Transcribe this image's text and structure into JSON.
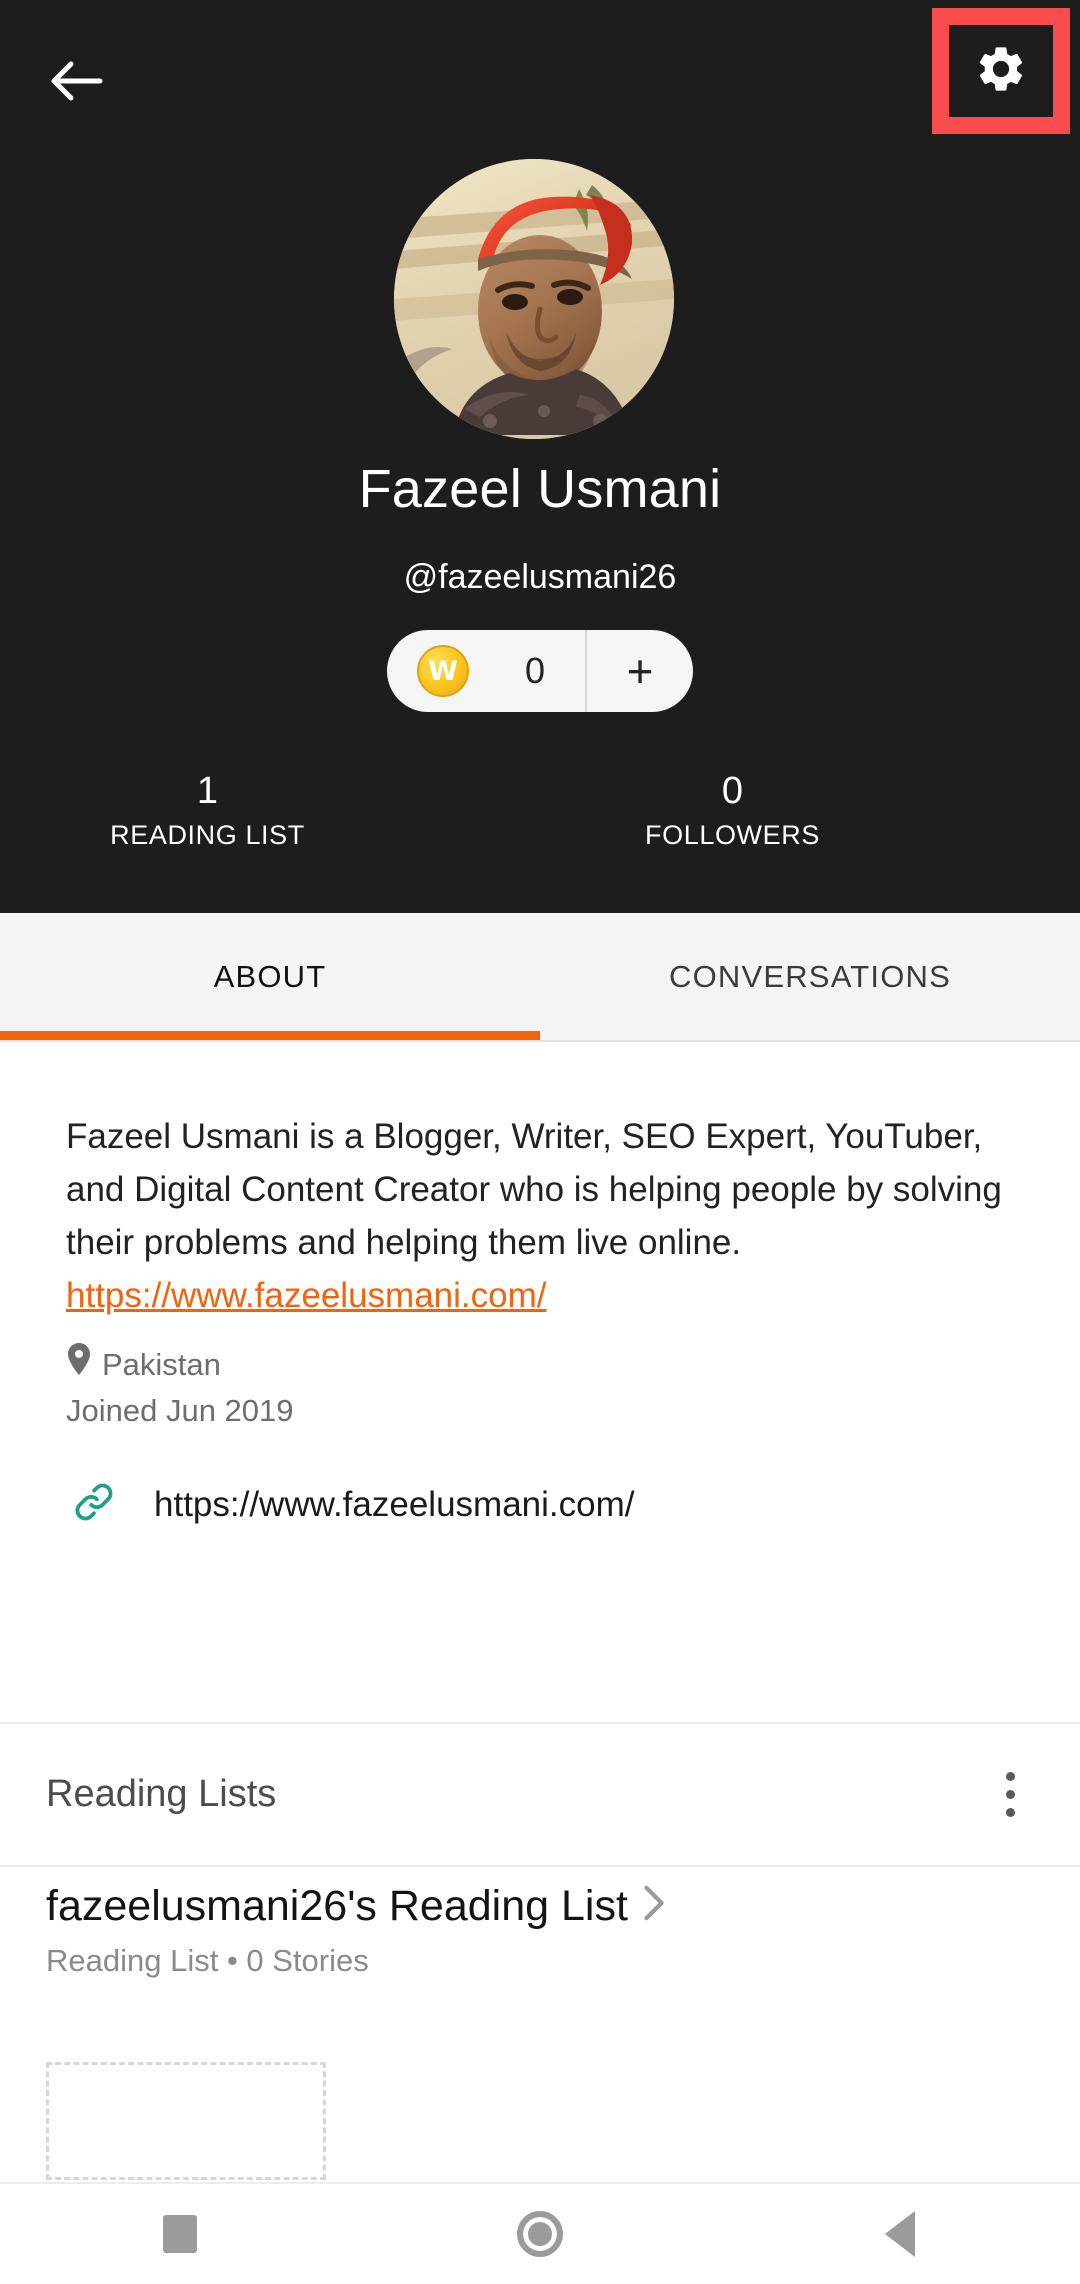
{
  "header": {
    "back_icon": "arrow-left-icon",
    "settings_icon": "gear-icon",
    "highlight_color": "#fb4d4d",
    "background_color": "#1d1d1d",
    "avatar_alt": "Profile photo of a man wearing a red cap",
    "display_name": "Fazeel Usmani",
    "username": "@fazeelusmani26"
  },
  "coins": {
    "icon": "wattpad-coin-icon",
    "icon_letter": "W",
    "count": "0",
    "add_label": "+"
  },
  "stats": [
    {
      "value": "1",
      "label": "READING LIST"
    },
    {
      "value": "0",
      "label": "FOLLOWERS"
    }
  ],
  "tabs": [
    {
      "label": "ABOUT",
      "active": true
    },
    {
      "label": "CONVERSATIONS",
      "active": false
    }
  ],
  "tab_indicator_color": "#f4620e",
  "about": {
    "bio_text": "Fazeel Usmani is a Blogger, Writer, SEO Expert, YouTuber, and Digital Content Creator who is helping people by solving their problems and helping them live online.",
    "bio_link": "https://www.fazeelusmani.com/",
    "location_icon": "location-pin-icon",
    "location": "Pakistan",
    "joined": "Joined Jun 2019",
    "website_icon": "link-chain-icon",
    "website_icon_color": "#1f9e8b",
    "website": "https://www.fazeelusmani.com/"
  },
  "reading_lists": {
    "section_title": "Reading Lists",
    "overflow_icon": "kebab-menu-icon",
    "items": [
      {
        "title": "fazeelusmani26's Reading List",
        "chevron_icon": "chevron-right-icon",
        "subtitle": "Reading List • 0 Stories"
      }
    ]
  },
  "navbar": {
    "recents": "square-icon",
    "home": "circle-icon",
    "back": "triangle-back-icon"
  }
}
